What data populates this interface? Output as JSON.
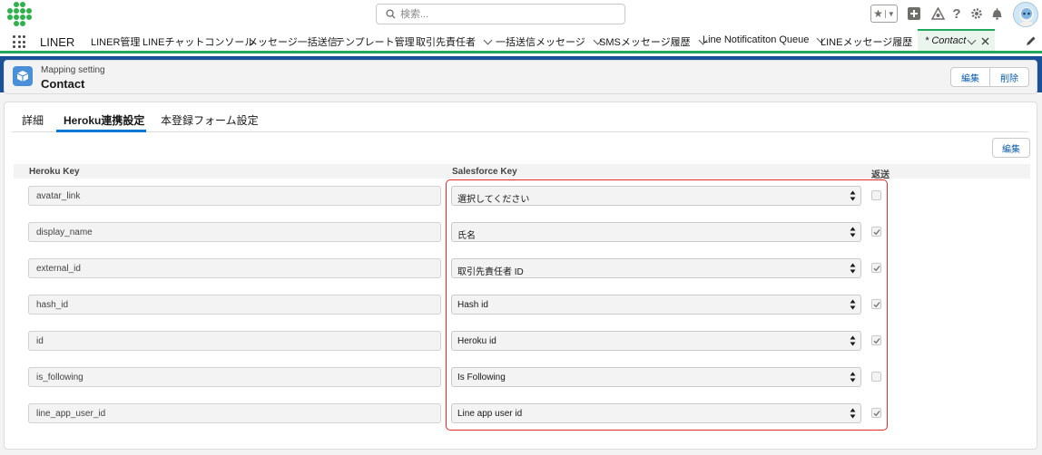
{
  "header": {
    "search_placeholder": "検索...",
    "icons": [
      "star-icon",
      "add-icon",
      "trailhead-icon",
      "help-icon",
      "settings-icon",
      "notification-bell-icon",
      "avatar"
    ]
  },
  "nav": {
    "app_name": "LINER",
    "items": [
      {
        "label": "LINER管理",
        "has_menu": false
      },
      {
        "label": "LINEチャットコンソール",
        "has_menu": false
      },
      {
        "label": "メッセージ一括送信",
        "has_menu": false
      },
      {
        "label": "テンプレート管理",
        "has_menu": false
      },
      {
        "label": "取引先責任者",
        "has_menu": true
      },
      {
        "label": "一括送信メッセージ",
        "has_menu": true
      },
      {
        "label": "SMSメッセージ履歴",
        "has_menu": true
      },
      {
        "label": "Line Notificatiton Queue",
        "has_menu": true
      },
      {
        "label": "LINEメッセージ履歴",
        "has_menu": true
      }
    ],
    "active_tab": {
      "label": "* Contact"
    }
  },
  "record": {
    "type_label": "Mapping setting",
    "name": "Contact",
    "edit_label": "編集",
    "delete_label": "削除"
  },
  "tabs": [
    {
      "label": "詳細",
      "active": false
    },
    {
      "label": "Heroku連携設定",
      "active": true
    },
    {
      "label": "本登録フォーム設定",
      "active": false
    }
  ],
  "edit_button_label": "編集",
  "table": {
    "headers": {
      "heroku_key": "Heroku Key",
      "salesforce_key": "Salesforce Key",
      "send_back": "返送"
    },
    "rows": [
      {
        "heroku_key": "avatar_link",
        "salesforce_key": "選択してください",
        "send_back": false
      },
      {
        "heroku_key": "display_name",
        "salesforce_key": "氏名",
        "send_back": true
      },
      {
        "heroku_key": "external_id",
        "salesforce_key": "取引先責任者 ID",
        "send_back": true
      },
      {
        "heroku_key": "hash_id",
        "salesforce_key": "Hash id",
        "send_back": true
      },
      {
        "heroku_key": "id",
        "salesforce_key": "Heroku id",
        "send_back": true
      },
      {
        "heroku_key": "is_following",
        "salesforce_key": "Is Following",
        "send_back": false
      },
      {
        "heroku_key": "line_app_user_id",
        "salesforce_key": "Line app user id",
        "send_back": true
      }
    ]
  },
  "colors": {
    "brand_green": "#22a85a",
    "link_blue": "#0b5cab",
    "accent_blue": "#0176d3",
    "highlight_red": "#e22b2b"
  }
}
